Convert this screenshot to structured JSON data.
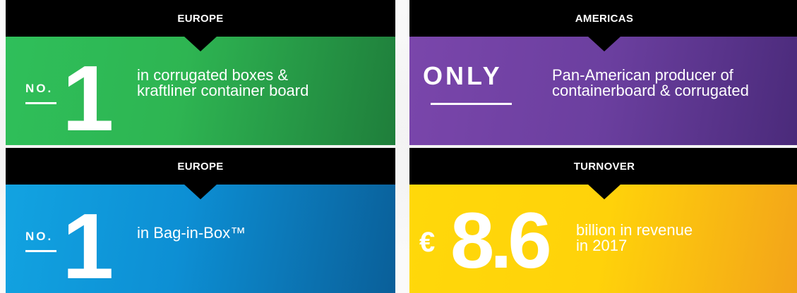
{
  "cards": [
    {
      "region": "EUROPE",
      "prefix": "NO.",
      "figure": "1",
      "description_line1": "in corrugated boxes &",
      "description_line2": "kraftliner container board",
      "color": "#2eb552"
    },
    {
      "region": "AMERICAS",
      "prefix": "ONLY",
      "description_line1": "Pan-American producer of",
      "description_line2": "containerboard & corrugated",
      "color": "#6b3f9f"
    },
    {
      "region": "EUROPE",
      "prefix": "NO.",
      "figure": "1",
      "description_line1": "in Bag-in-Box™",
      "description_line2": "",
      "color": "#0d8fd4"
    },
    {
      "region": "TURNOVER",
      "currency": "€",
      "figure": "8.6",
      "description_line1": "billion in revenue",
      "description_line2": "in 2017",
      "color": "#ffd20a"
    }
  ]
}
